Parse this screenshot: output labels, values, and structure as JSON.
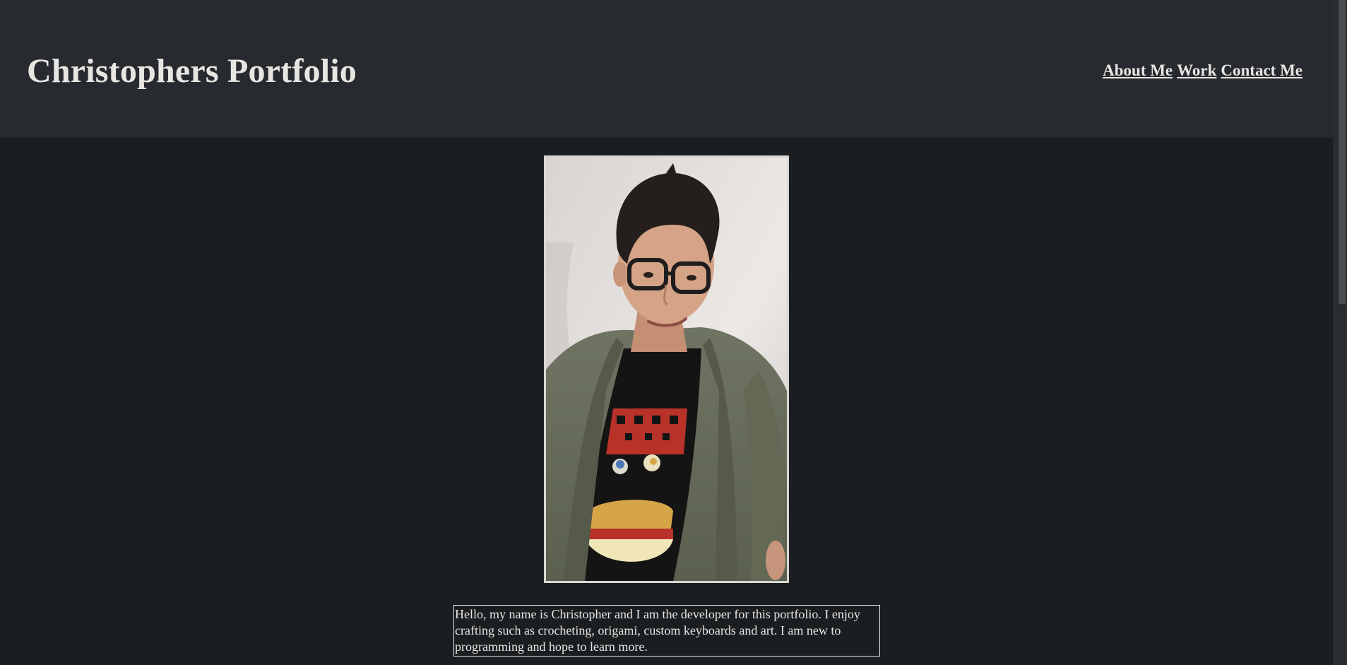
{
  "header": {
    "title": "Christophers Portfolio",
    "nav": [
      {
        "label": "About Me"
      },
      {
        "label": "Work"
      },
      {
        "label": "Contact Me"
      }
    ]
  },
  "main": {
    "bio": "Hello, my name is Christopher and I am the developer for this portfolio. I enjoy crafting such as crocheting, origami, custom keyboards and art. I am new to programming and hope to learn more."
  },
  "colors": {
    "page_background": "#1b1e20",
    "header_background": "#272a2e",
    "text": "#e8e6e3"
  }
}
